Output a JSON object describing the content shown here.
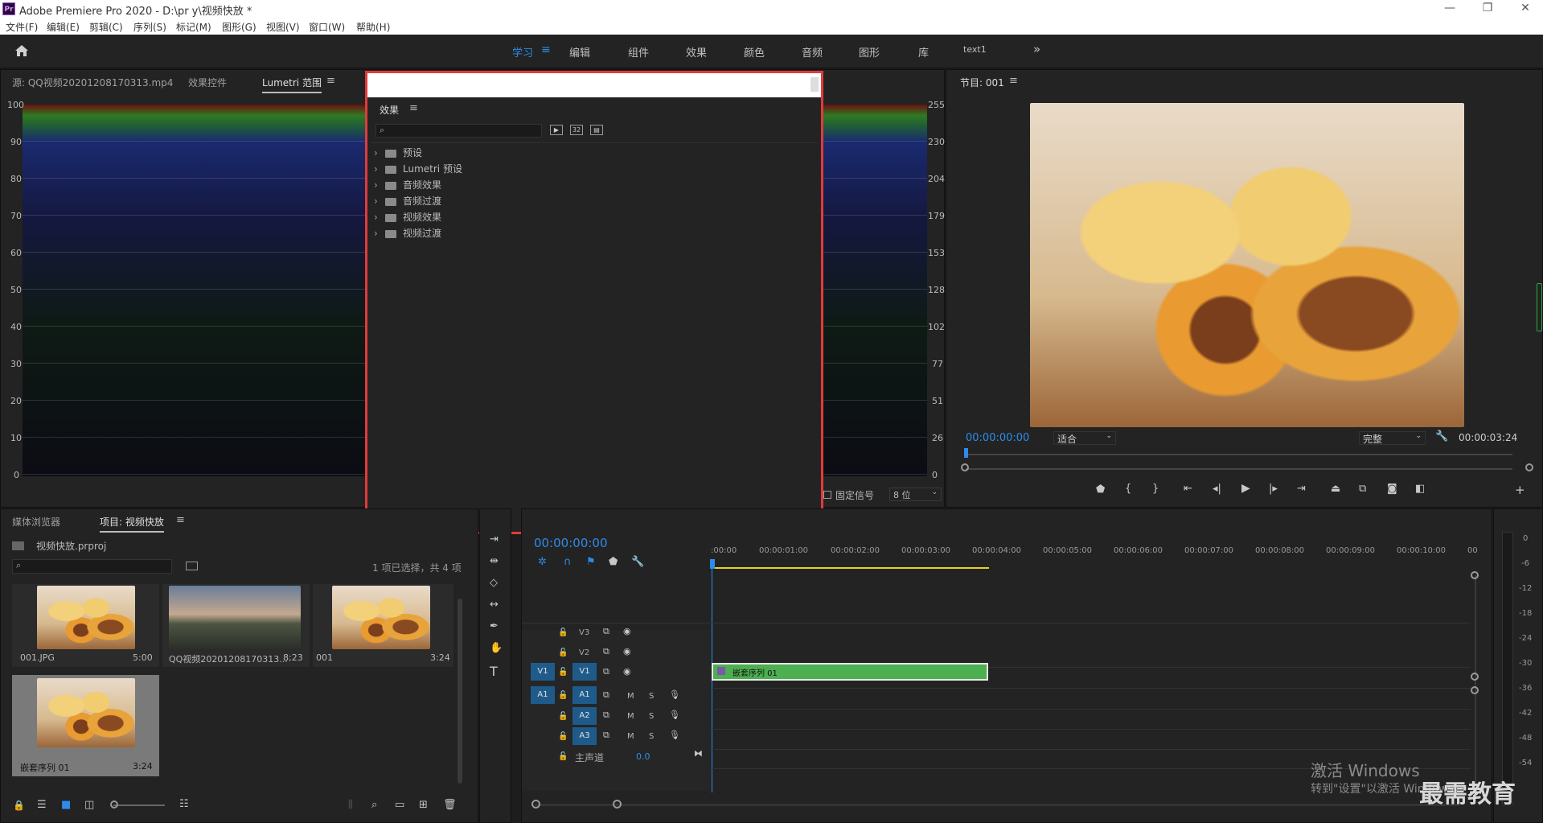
{
  "app": {
    "title": "Adobe Premiere Pro 2020 - D:\\pr y\\视频快放 *",
    "logo": "Pr"
  },
  "window_controls": {
    "minimize": "—",
    "restore": "❐",
    "close": "✕"
  },
  "menu": [
    "文件(F)",
    "编辑(E)",
    "剪辑(C)",
    "序列(S)",
    "标记(M)",
    "图形(G)",
    "视图(V)",
    "窗口(W)",
    "帮助(H)"
  ],
  "workspaces": [
    "学习",
    "编辑",
    "组件",
    "效果",
    "颜色",
    "音频",
    "图形",
    "库",
    "text1"
  ],
  "workspace_more": "»",
  "source_panel": {
    "tabs": [
      "源: QQ视频20201208170313.mp4",
      "效果控件",
      "Lumetri 范围"
    ],
    "left_scale": [
      "100",
      "90",
      "80",
      "70",
      "60",
      "50",
      "40",
      "30",
      "20",
      "10",
      "0"
    ],
    "right_scale": [
      "255",
      "230",
      "204",
      "179",
      "153",
      "128",
      "102",
      "77",
      "51",
      "26",
      "0"
    ],
    "clamp_label": "固定信号",
    "bit_depth": "8 位"
  },
  "effects_panel": {
    "title": "效果",
    "search_placeholder": "",
    "items": [
      "预设",
      "Lumetri 预设",
      "音频效果",
      "音频过渡",
      "视频效果",
      "视频过渡"
    ]
  },
  "program_monitor": {
    "title": "节目: 001",
    "timecode": "00:00:00:00",
    "fit": "适合",
    "quality": "完整",
    "duration": "00:00:03:24"
  },
  "project_panel": {
    "tabs": [
      "媒体浏览器",
      "项目: 视频快放"
    ],
    "file": "视频快放.prproj",
    "selection": "1 项已选择，共 4 项",
    "items": [
      {
        "name": "001.JPG",
        "dur": "5:00"
      },
      {
        "name": "QQ视频20201208170313...",
        "dur": "8;23"
      },
      {
        "name": "001",
        "dur": "3:24"
      },
      {
        "name": "嵌套序列 01",
        "dur": "3:24"
      }
    ]
  },
  "timeline": {
    "timecode": "00:00:00:00",
    "ruler": [
      ":00:00",
      "00:00:01:00",
      "00:00:02:00",
      "00:00:03:00",
      "00:00:04:00",
      "00:00:05:00",
      "00:00:06:00",
      "00:00:07:00",
      "00:00:08:00",
      "00:00:09:00",
      "00:00:10:00",
      "00"
    ],
    "video_tracks": [
      "V3",
      "V2",
      "V1"
    ],
    "audio_tracks": [
      "A1",
      "A2",
      "A3"
    ],
    "master": "主声道",
    "master_value": "0.0",
    "clip": "嵌套序列 01",
    "m": "M",
    "s": "S"
  },
  "meter_scale": [
    "0",
    "-6",
    "-12",
    "-18",
    "-24",
    "-30",
    "-36",
    "-42",
    "-48",
    "-54"
  ],
  "watermark": {
    "line1": "激活 Windows",
    "line2": "转到\"设置\"以激活 Windows。",
    "brand": "最需教育"
  },
  "colors": {
    "accent": "#2d8ceb",
    "highlight_border": "#e23a3a",
    "clip_green": "#4caf50"
  }
}
